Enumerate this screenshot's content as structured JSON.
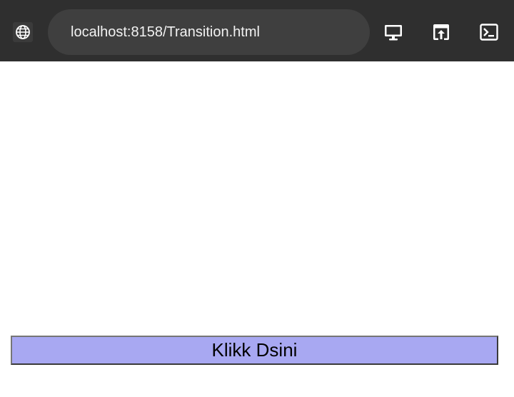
{
  "browser": {
    "url": "localhost:8158/Transition.html",
    "icons": {
      "site": "globe-icon",
      "desktop": "desktop-icon",
      "share": "share-icon",
      "console": "terminal-icon"
    },
    "colors": {
      "toolbar": "#2f2f2f",
      "url_bar": "#3f3f3f",
      "icon": "#ffffff"
    }
  },
  "page": {
    "button_label": "Klikk Dsini",
    "colors": {
      "button_background": "#a8a8f2"
    }
  }
}
